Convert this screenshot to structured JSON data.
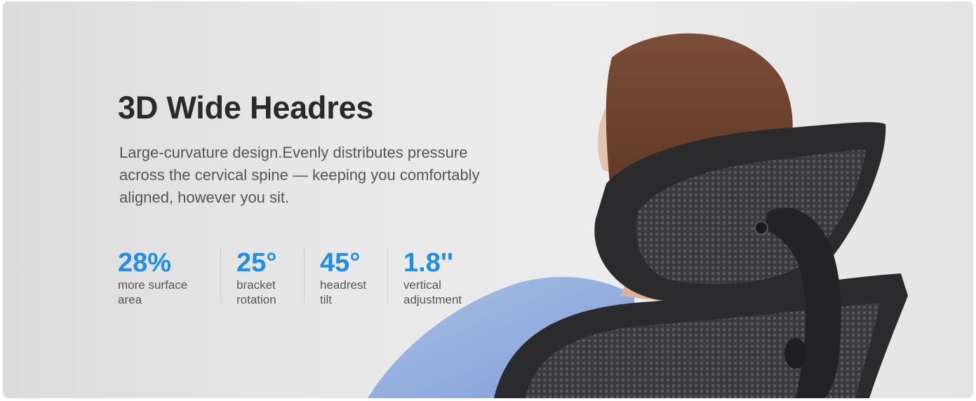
{
  "banner": {
    "title": "3D Wide Headres",
    "description": "Large-curvature design.Evenly distributes pressure across the cervical spine — keeping you comfortably aligned, however you sit.",
    "stats": [
      {
        "value": "28%",
        "label": "more surface area"
      },
      {
        "value": "25°",
        "label": "bracket rotation"
      },
      {
        "value": "45°",
        "label": "headrest tilt"
      },
      {
        "value": "1.8''",
        "label": "vertical adjustment"
      }
    ]
  },
  "colors": {
    "accent": "#1f8fe4",
    "title": "#2a2a2a",
    "body_text": "#555555"
  }
}
